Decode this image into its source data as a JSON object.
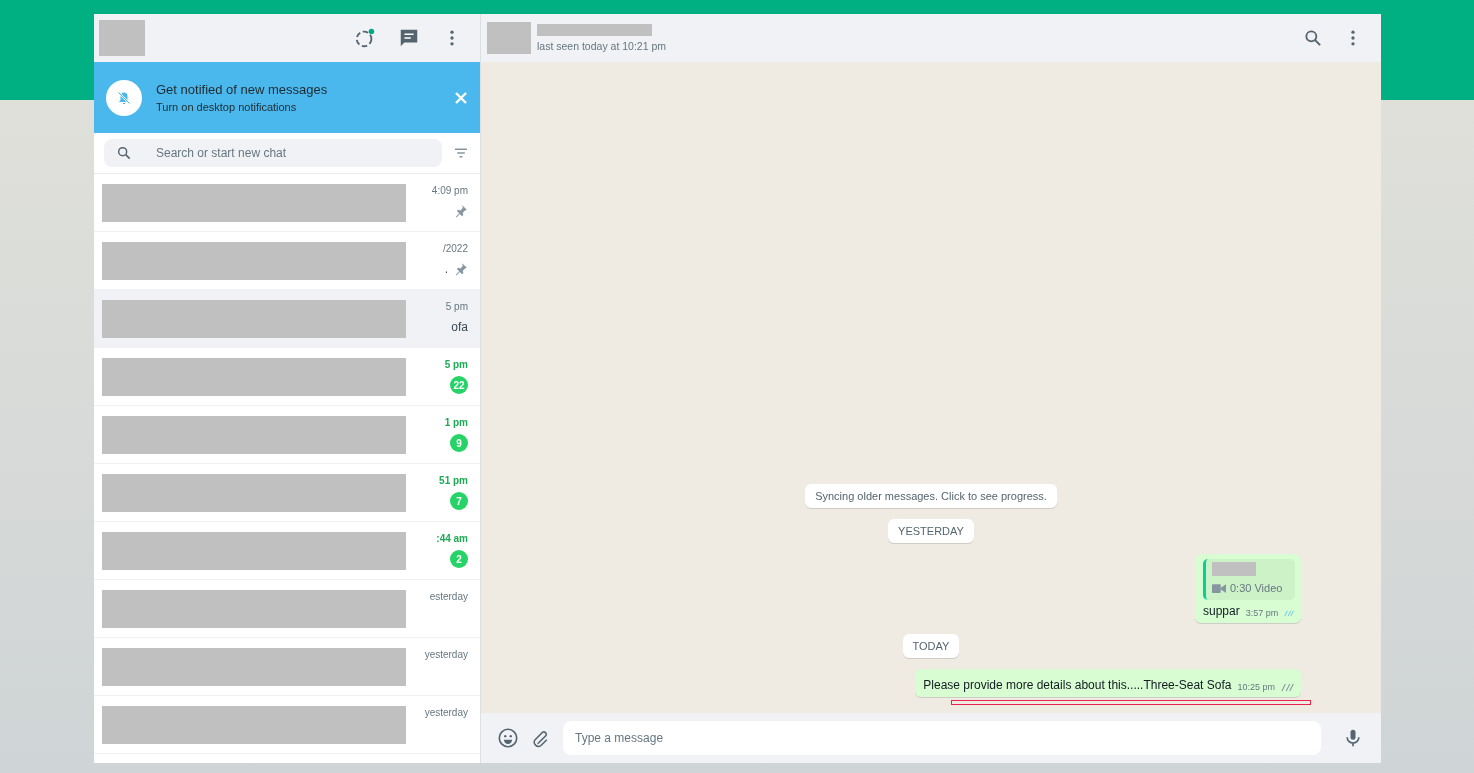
{
  "sidebar_header": {
    "status_dot": true
  },
  "notification_banner": {
    "title": "Get notified of new messages",
    "link": "Turn on desktop notifications"
  },
  "search": {
    "placeholder": "Search or start new chat"
  },
  "chats": [
    {
      "time": "4:09 pm",
      "unread": false,
      "pinned": true,
      "selected": false
    },
    {
      "time": "/2022",
      "unread": false,
      "pinned": true,
      "preview": ".",
      "selected": false
    },
    {
      "time": "5 pm",
      "unread": false,
      "pinned": false,
      "preview": "ofa",
      "selected": true
    },
    {
      "time": "5 pm",
      "unread": true,
      "badge": "22",
      "pinned": false,
      "selected": false
    },
    {
      "time": "1 pm",
      "unread": true,
      "badge": "9",
      "pinned": false,
      "selected": false
    },
    {
      "time": "51 pm",
      "unread": true,
      "badge": "7",
      "pinned": false,
      "selected": false
    },
    {
      "time": ":44 am",
      "unread": true,
      "badge": "2",
      "pinned": false,
      "selected": false
    },
    {
      "time": "esterday",
      "unread": false,
      "pinned": false,
      "selected": false
    },
    {
      "time": "yesterday",
      "unread": false,
      "pinned": false,
      "selected": false
    },
    {
      "time": "yesterday",
      "unread": false,
      "pinned": false,
      "selected": false
    }
  ],
  "conversation_header": {
    "status": "last seen today at 10:21 pm"
  },
  "messages": [
    {
      "kind": "notice",
      "text": "Syncing older messages. Click to see progress."
    },
    {
      "kind": "date",
      "text": "YESTERDAY"
    },
    {
      "kind": "video",
      "text": "suppar",
      "video_label": "0:30 Video",
      "time": "3:57 pm",
      "read": true
    },
    {
      "kind": "date",
      "text": "TODAY"
    },
    {
      "kind": "text",
      "text": "Please provide more details about this.....Three-Seat Sofa",
      "time": "10:25 pm",
      "read": false
    }
  ],
  "composer": {
    "placeholder": "Type a message"
  }
}
